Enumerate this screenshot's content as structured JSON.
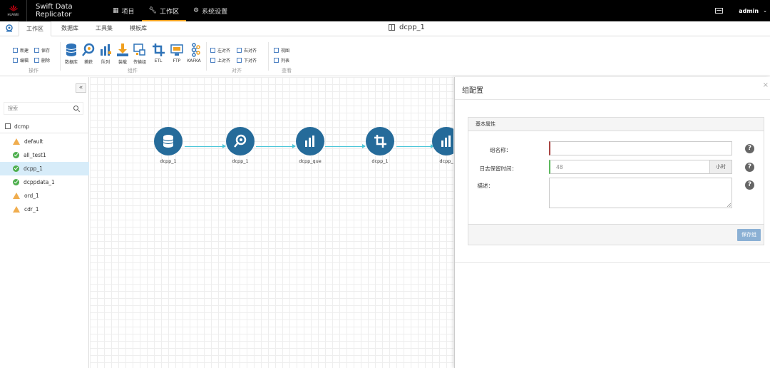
{
  "topbar": {
    "brand": "HUAWEI",
    "app_title": "Swift Data Replicator",
    "nav": [
      {
        "label": "项目",
        "icon": "table-icon"
      },
      {
        "label": "工作区",
        "icon": "wrench-icon",
        "active": true
      },
      {
        "label": "系统设置",
        "icon": "gear-icon"
      }
    ],
    "user": "admin"
  },
  "tabs": [
    {
      "label": "工作区",
      "active": true
    },
    {
      "label": "数据库"
    },
    {
      "label": "工具集"
    },
    {
      "label": "模板库"
    }
  ],
  "doc_title": "dcpp_1",
  "ribbon": {
    "ops": {
      "label": "操作",
      "new": "新建",
      "save": "保存",
      "edit": "编辑",
      "delete": "删除"
    },
    "components": {
      "label": "组件",
      "items": [
        "数据库",
        "捕获",
        "队列",
        "装载",
        "传输组",
        "ETL",
        "FTP",
        "KAFKA"
      ]
    },
    "align": {
      "label": "对齐",
      "left": "左对齐",
      "right": "右对齐",
      "top": "上对齐",
      "bottom": "下对齐"
    },
    "view": {
      "label": "查看",
      "diagram": "视图",
      "list": "列表"
    }
  },
  "sidebar": {
    "collapse": "«",
    "search_placeholder": "搜索",
    "root": "dcmp",
    "items": [
      {
        "label": "default",
        "status": "warn"
      },
      {
        "label": "all_test1",
        "status": "ok"
      },
      {
        "label": "dcpp_1",
        "status": "ok",
        "selected": true
      },
      {
        "label": "dcppdata_1",
        "status": "ok"
      },
      {
        "label": "ord_1",
        "status": "warn"
      },
      {
        "label": "cdr_1",
        "status": "warn"
      }
    ]
  },
  "flow": {
    "nodes": [
      {
        "label": "dcpp_1",
        "icon": "database-icon"
      },
      {
        "label": "dcpp_1",
        "icon": "capture-icon"
      },
      {
        "label": "dcpp_que",
        "icon": "queue-icon"
      },
      {
        "label": "dcpp_1",
        "icon": "crop-icon"
      },
      {
        "label": "dcpp_",
        "icon": "load-icon"
      }
    ]
  },
  "panel": {
    "title": "组配置",
    "close": "×",
    "section": "基本属性",
    "name_label": "组名称：",
    "name_value": "",
    "retention_label": "日志保留时间：",
    "retention_value": "48",
    "retention_unit": "小时",
    "desc_label": "描述：",
    "desc_value": "",
    "help": "?",
    "save": "保存组"
  },
  "colors": {
    "node": "#256b9a",
    "link": "#4cc6d8",
    "accent": "#f0a020",
    "save_button": "#8bb0d4"
  }
}
